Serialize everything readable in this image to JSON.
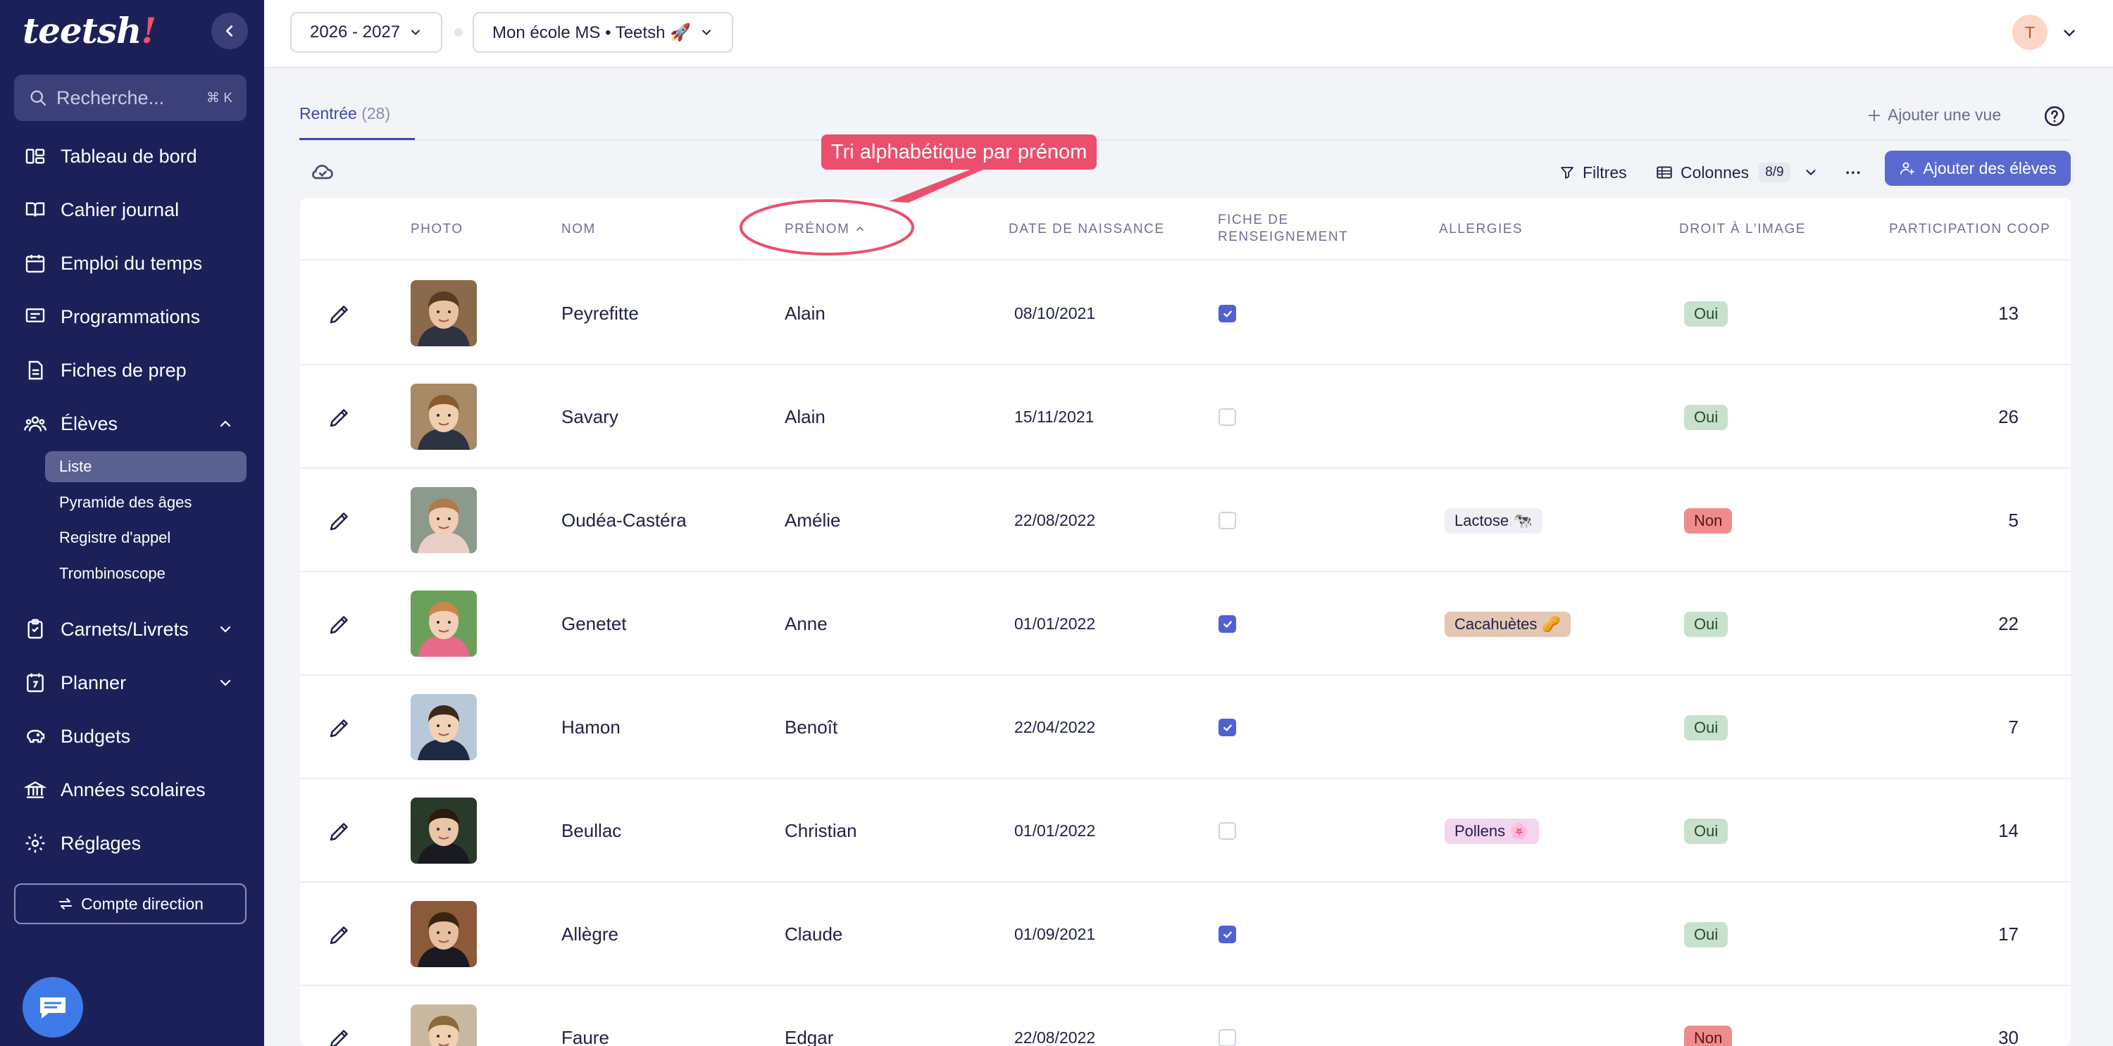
{
  "app": {
    "logo": "teetsh"
  },
  "sidebar": {
    "search_placeholder": "Recherche...",
    "search_shortcut": "⌘ K",
    "items": [
      {
        "label": "Tableau de bord",
        "icon": "dashboard-icon"
      },
      {
        "label": "Cahier journal",
        "icon": "book-icon"
      },
      {
        "label": "Emploi du temps",
        "icon": "calendar-icon"
      },
      {
        "label": "Programmations",
        "icon": "presentation-icon"
      },
      {
        "label": "Fiches de prep",
        "icon": "document-icon"
      },
      {
        "label": "Élèves",
        "icon": "users-icon"
      },
      {
        "label": "Carnets/Livrets",
        "icon": "clipboard-icon"
      },
      {
        "label": "Planner",
        "icon": "planner-icon"
      },
      {
        "label": "Budgets",
        "icon": "piggy-bank-icon"
      },
      {
        "label": "Années scolaires",
        "icon": "bank-icon"
      },
      {
        "label": "Réglages",
        "icon": "gear-icon"
      }
    ],
    "sub_items": [
      "Liste",
      "Pyramide des âges",
      "Registre d'appel",
      "Trombinoscope"
    ],
    "account_button": "Compte direction"
  },
  "topbar": {
    "year": "2026 - 2027",
    "school": "Mon école MS • Teetsh 🚀",
    "avatar_initial": "T"
  },
  "tabs": {
    "active_label": "Rentrée",
    "active_count": "(28)",
    "add_view": "Ajouter une vue"
  },
  "toolbar": {
    "filters": "Filtres",
    "columns": "Colonnes",
    "columns_count": "8/9",
    "more": "···",
    "add_students": "Ajouter des élèves"
  },
  "annotation": "Tri alphabétique par prénom",
  "table": {
    "headers": {
      "photo": "PHOTO",
      "nom": "NOM",
      "prenom": "PRÉNOM",
      "naissance": "DATE DE NAISSANCE",
      "fiche_1": "FICHE DE",
      "fiche_2": "RENSEIGNEMENT",
      "allergies": "ALLERGIES",
      "droit": "DROIT À L'IMAGE",
      "coop": "PARTICIPATION COOP"
    },
    "rows": [
      {
        "nom": "Peyrefitte",
        "prenom": "Alain",
        "naissance": "08/10/2021",
        "fiche": true,
        "allergie": "",
        "droit": "Oui",
        "coop": "13"
      },
      {
        "nom": "Savary",
        "prenom": "Alain",
        "naissance": "15/11/2021",
        "fiche": false,
        "allergie": "",
        "droit": "Oui",
        "coop": "26"
      },
      {
        "nom": "Oudéa-Castéra",
        "prenom": "Amélie",
        "naissance": "22/08/2022",
        "fiche": false,
        "allergie": "Lactose 🐄",
        "droit": "Non",
        "coop": "5"
      },
      {
        "nom": "Genetet",
        "prenom": "Anne",
        "naissance": "01/01/2022",
        "fiche": true,
        "allergie": "Cacahuètes 🥜",
        "droit": "Oui",
        "coop": "22"
      },
      {
        "nom": "Hamon",
        "prenom": "Benoît",
        "naissance": "22/04/2022",
        "fiche": true,
        "allergie": "",
        "droit": "Oui",
        "coop": "7"
      },
      {
        "nom": "Beullac",
        "prenom": "Christian",
        "naissance": "01/01/2022",
        "fiche": false,
        "allergie": "Pollens 🌸",
        "droit": "Oui",
        "coop": "14"
      },
      {
        "nom": "Allègre",
        "prenom": "Claude",
        "naissance": "01/09/2021",
        "fiche": true,
        "allergie": "",
        "droit": "Oui",
        "coop": "17"
      },
      {
        "nom": "Faure",
        "prenom": "Edgar",
        "naissance": "22/08/2022",
        "fiche": false,
        "allergie": "",
        "droit": "Non",
        "coop": "30"
      }
    ]
  },
  "colors": {
    "sidebar_bg": "#1b2158",
    "accent": "#5b6ad0",
    "annotation": "#ec4e6d",
    "tag_yes": "#c9e0cd",
    "tag_no": "#f08b8b",
    "allergy_lactose": "#eef0f6",
    "allergy_cacahuetes": "#e4c7b5",
    "allergy_pollens": "#f3d5ef"
  }
}
